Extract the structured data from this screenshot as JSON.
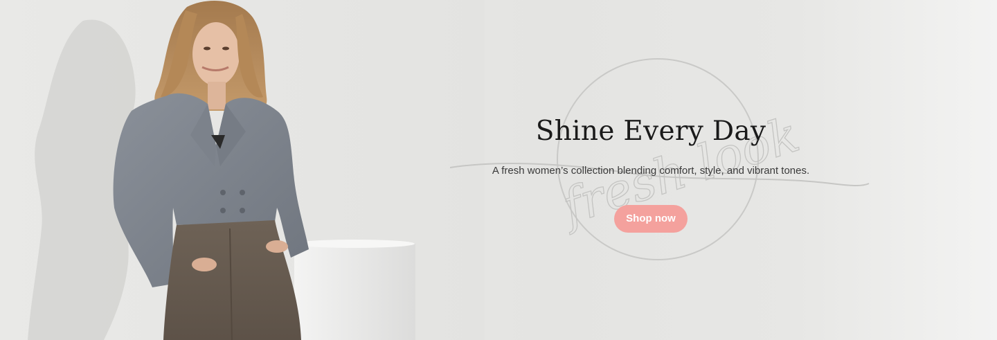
{
  "hero": {
    "title": "Shine Every Day",
    "subtitle": "A fresh women’s collection blending comfort, style, and vibrant tones.",
    "cta_label": "Shop now",
    "watermark_text": "fresh look"
  },
  "colors": {
    "cta_background": "#f4a19d",
    "cta_text": "#ffffff",
    "title_text": "#1a1a1a",
    "subtitle_text": "#3a3a3a"
  }
}
